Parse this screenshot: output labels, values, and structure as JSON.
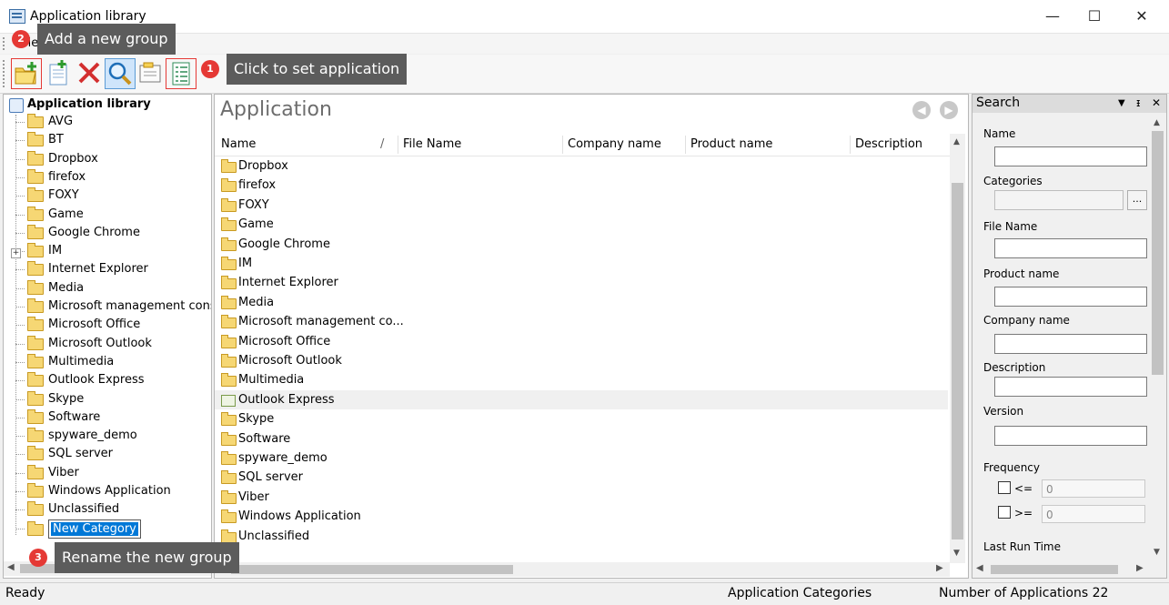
{
  "window": {
    "title": "Application library",
    "minimize_glyph": "—",
    "maximize_glyph": "☐",
    "close_glyph": "✕",
    "icon": "app-library-icon"
  },
  "menu": {
    "items": [
      "View"
    ]
  },
  "toolbar": {
    "buttons": [
      "new-group-icon",
      "add-application-icon",
      "delete-icon",
      "search-icon",
      "properties-icon",
      "set-application-icon"
    ]
  },
  "tree": {
    "root_label": "Application library",
    "items": [
      "AVG",
      "BT",
      "Dropbox",
      "firefox",
      "FOXY",
      "Game",
      "Google Chrome",
      "IM",
      "Internet Explorer",
      "Media",
      "Microsoft management conso",
      "Microsoft Office",
      "Microsoft Outlook",
      "Multimedia",
      "Outlook Express",
      "Skype",
      "Software",
      "spyware_demo",
      "SQL server",
      "Viber",
      "Windows Application",
      "Unclassified"
    ],
    "new_item_label": "New Category",
    "expander": "+"
  },
  "main": {
    "title": "Application",
    "nav_back": "◀",
    "nav_forward": "▶",
    "columns": [
      "Name",
      "File Name",
      "Company name",
      "Product name",
      "Description"
    ],
    "sort_glyph": "/",
    "rows": [
      {
        "name": "Dropbox",
        "type": "folder"
      },
      {
        "name": "firefox",
        "type": "folder"
      },
      {
        "name": "FOXY",
        "type": "folder"
      },
      {
        "name": "Game",
        "type": "folder"
      },
      {
        "name": "Google Chrome",
        "type": "folder"
      },
      {
        "name": "IM",
        "type": "folder"
      },
      {
        "name": "Internet Explorer",
        "type": "folder"
      },
      {
        "name": "Media",
        "type": "folder"
      },
      {
        "name": "Microsoft management co...",
        "type": "folder"
      },
      {
        "name": "Microsoft Office",
        "type": "folder"
      },
      {
        "name": "Microsoft Outlook",
        "type": "folder"
      },
      {
        "name": "Multimedia",
        "type": "folder"
      },
      {
        "name": "Outlook Express",
        "type": "app"
      },
      {
        "name": "Skype",
        "type": "folder"
      },
      {
        "name": "Software",
        "type": "folder"
      },
      {
        "name": "spyware_demo",
        "type": "folder"
      },
      {
        "name": "SQL server",
        "type": "folder"
      },
      {
        "name": "Viber",
        "type": "folder"
      },
      {
        "name": "Windows Application",
        "type": "folder"
      },
      {
        "name": "Unclassified",
        "type": "folder"
      }
    ]
  },
  "search": {
    "title": "Search",
    "dropdown_glyph": "▼",
    "pin_glyph": "ᵻ",
    "close_glyph": "✕",
    "fields": {
      "name": "Name",
      "categories": "Categories",
      "browse": "...",
      "file_name": "File Name",
      "product_name": "Product name",
      "company_name": "Company name",
      "description": "Description",
      "version": "Version",
      "frequency": "Frequency",
      "lte": "<=",
      "gte": ">=",
      "lte_value": "0",
      "gte_value": "0",
      "last_run_time": "Last Run Time"
    }
  },
  "status": {
    "left": "Ready",
    "categories": "Application Categories",
    "count": "Number of Applications 22"
  },
  "tooltips": {
    "add_group": {
      "badge": "2",
      "text": "Add a new group"
    },
    "set_application": {
      "badge": "1",
      "text": "Click to set application"
    },
    "rename_group": {
      "badge": "3",
      "text": "Rename the new group"
    }
  },
  "scroll": {
    "up": "▲",
    "down": "▼",
    "left": "◀",
    "right": "▶"
  },
  "colors": {
    "highlight": "#e53935",
    "selection": "#0078d7",
    "tooltip": "#5c5c5c"
  }
}
